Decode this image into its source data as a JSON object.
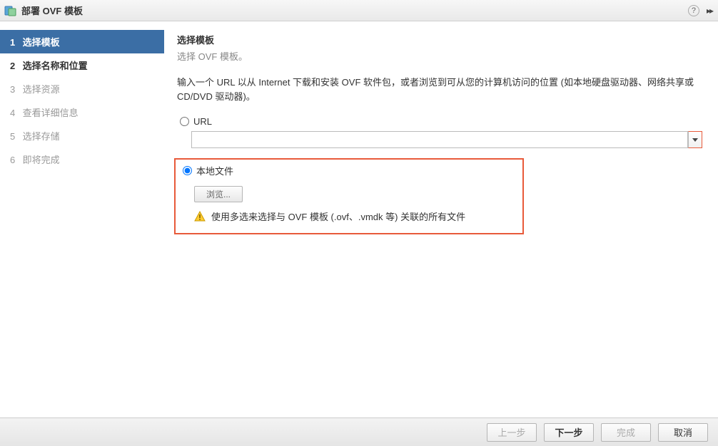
{
  "titlebar": {
    "title": "部署 OVF 模板"
  },
  "steps": [
    {
      "num": "1",
      "label": "选择模板",
      "state": "active"
    },
    {
      "num": "2",
      "label": "选择名称和位置",
      "state": "done"
    },
    {
      "num": "3",
      "label": "选择资源",
      "state": "pending"
    },
    {
      "num": "4",
      "label": "查看详细信息",
      "state": "pending"
    },
    {
      "num": "5",
      "label": "选择存储",
      "state": "pending"
    },
    {
      "num": "6",
      "label": "即将完成",
      "state": "pending"
    }
  ],
  "content": {
    "title": "选择模板",
    "subtitle": "选择 OVF 模板。",
    "description": "输入一个 URL 以从 Internet 下载和安装 OVF 软件包，或者浏览到可从您的计算机访问的位置 (如本地硬盘驱动器、网络共享或 CD/DVD 驱动器)。",
    "url_label": "URL",
    "local_label": "本地文件",
    "browse_button": "浏览...",
    "warning_text": "使用多选来选择与 OVF 模板 (.ovf、.vmdk 等) 关联的所有文件",
    "source_selected": "local"
  },
  "footer": {
    "back": "上一步",
    "next": "下一步",
    "finish": "完成",
    "cancel": "取消"
  }
}
